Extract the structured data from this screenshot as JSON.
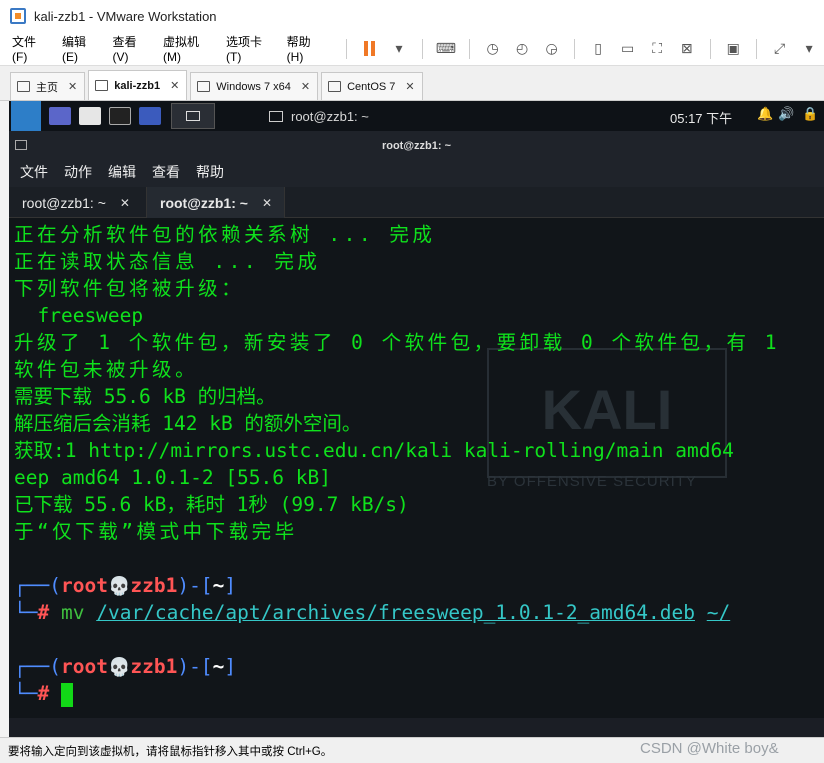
{
  "window": {
    "title": "kali-zzb1 - VMware Workstation"
  },
  "menubar": {
    "items": [
      "文件(F)",
      "编辑(E)",
      "查看(V)",
      "虚拟机(M)",
      "选项卡(T)",
      "帮助(H)"
    ]
  },
  "vm_tabs": [
    {
      "label": "主页",
      "icon": "home-icon"
    },
    {
      "label": "kali-zzb1",
      "icon": "vm-icon",
      "active": true
    },
    {
      "label": "Windows 7 x64",
      "icon": "vm-icon"
    },
    {
      "label": "CentOS 7",
      "icon": "vm-icon"
    }
  ],
  "guest_panel": {
    "task_title": "root@zzb1: ~",
    "clock": "05:17 下午"
  },
  "terminal": {
    "title": "root@zzb1: ~",
    "menu": [
      "文件",
      "动作",
      "编辑",
      "查看",
      "帮助"
    ],
    "tabs": [
      {
        "label": "root@zzb1: ~",
        "active": false
      },
      {
        "label": "root@zzb1: ~",
        "active": true
      }
    ],
    "lines": [
      "正在分析软件包的依赖关系树 ... 完成",
      "正在读取状态信息 ... 完成",
      "下列软件包将被升级：",
      "  freesweep",
      "升级了 1 个软件包，新安装了 0 个软件包，要卸载 0 个软件包，有 1",
      "软件包未被升级。",
      "需要下载 55.6 kB 的归档。",
      "解压缩后会消耗 142 kB 的额外空间。",
      "获取:1 http://mirrors.ustc.edu.cn/kali kali-rolling/main amd64",
      "eep amd64 1.0.1-2 [55.6 kB]",
      "已下载 55.6 kB，耗时 1秒 (99.7 kB/s)",
      "于“仅下载”模式中下载完毕"
    ],
    "prompt_user": "root",
    "prompt_host": "zzb1",
    "prompt_dir": "~",
    "command": "mv",
    "arg1": "/var/cache/apt/archives/freesweep_1.0.1-2_amd64.deb",
    "arg2": "~/",
    "watermark": "KALI",
    "watermark_sub": "BY OFFENSIVE SECURITY"
  },
  "status": {
    "text": "要将输入定向到该虚拟机，请将鼠标指针移入其中或按 Ctrl+G。"
  },
  "corner_watermark": "CSDN @White boy&"
}
